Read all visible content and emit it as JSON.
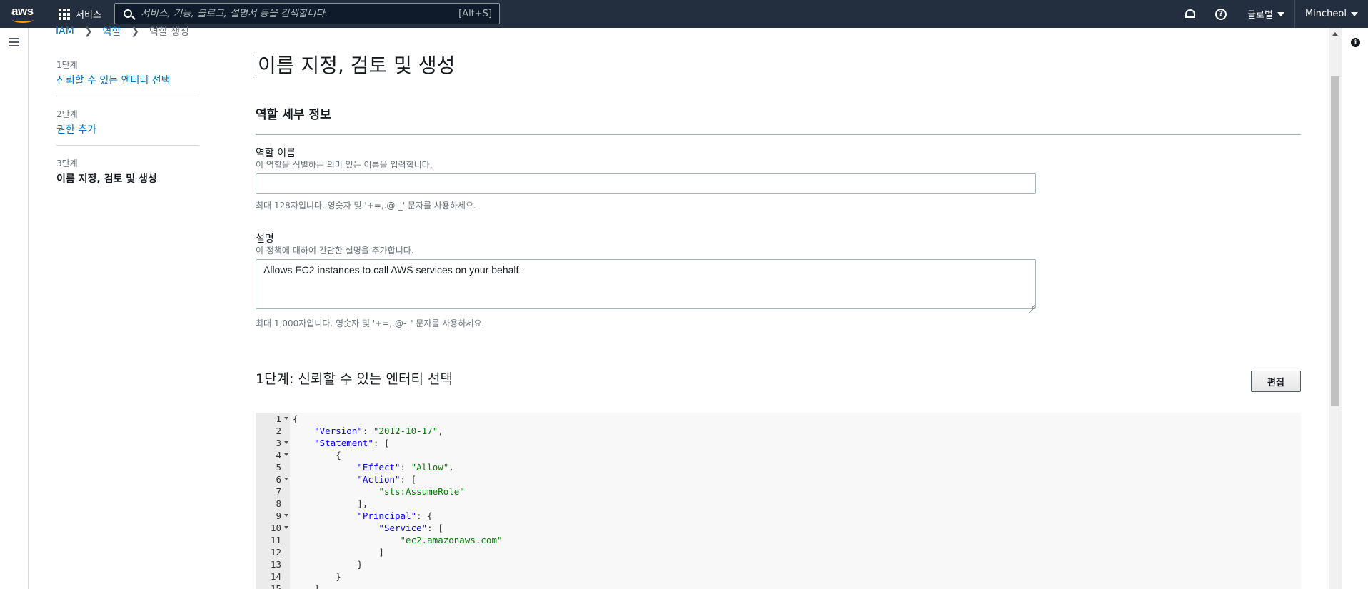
{
  "topnav": {
    "logo": "aws",
    "services_label": "서비스",
    "search_placeholder": "서비스, 기능, 블로그, 설명서 등을 검색합니다.",
    "search_shortcut": "[Alt+S]",
    "region_label": "글로벌",
    "account_label": "Mincheol",
    "icons": [
      "grid-icon",
      "search-icon",
      "bell-icon",
      "help-icon",
      "caret-down-icon"
    ]
  },
  "breadcrumb": {
    "items": [
      "IAM",
      "역할",
      "역할 생성"
    ]
  },
  "steps": [
    {
      "num": "1단계",
      "label": "신뢰할 수 있는 엔터티 선택",
      "state": "link"
    },
    {
      "num": "2단계",
      "label": "권한 추가",
      "state": "link"
    },
    {
      "num": "3단계",
      "label": "이름 지정, 검토 및 생성",
      "state": "active"
    }
  ],
  "page": {
    "title": "이름 지정, 검토 및 생성",
    "section_title": "역할 세부 정보"
  },
  "role_name": {
    "label": "역할 이름",
    "description": "이 역할을 식별하는 의미 있는 이름을 입력합니다.",
    "value": "",
    "hint": "최대 128자입니다. 영숫자 및 '+=,.@-_' 문자를 사용하세요."
  },
  "role_description": {
    "label": "설명",
    "description": "이 정책에 대하여 간단한 설명을 추가합니다.",
    "value": "Allows EC2 instances to call AWS services on your behalf.",
    "hint": "최대 1,000자입니다. 영숫자 및 '+=,.@-_' 문자를 사용하세요."
  },
  "step1": {
    "title": "1단계: 신뢰할 수 있는 엔터티 선택",
    "edit_label": "편집"
  },
  "policy_editor": {
    "lines": [
      {
        "n": "1",
        "fold": true,
        "text": "{"
      },
      {
        "n": "2",
        "fold": false,
        "text": "    \"Version\": \"2012-10-17\","
      },
      {
        "n": "3",
        "fold": true,
        "text": "    \"Statement\": ["
      },
      {
        "n": "4",
        "fold": true,
        "text": "        {"
      },
      {
        "n": "5",
        "fold": false,
        "text": "            \"Effect\": \"Allow\","
      },
      {
        "n": "6",
        "fold": true,
        "text": "            \"Action\": ["
      },
      {
        "n": "7",
        "fold": false,
        "text": "                \"sts:AssumeRole\""
      },
      {
        "n": "8",
        "fold": false,
        "text": "            ],"
      },
      {
        "n": "9",
        "fold": true,
        "text": "            \"Principal\": {"
      },
      {
        "n": "10",
        "fold": true,
        "text": "                \"Service\": ["
      },
      {
        "n": "11",
        "fold": false,
        "text": "                    \"ec2.amazonaws.com\""
      },
      {
        "n": "12",
        "fold": false,
        "text": "                ]"
      },
      {
        "n": "13",
        "fold": false,
        "text": "            }"
      },
      {
        "n": "14",
        "fold": false,
        "text": "        }"
      },
      {
        "n": "15",
        "fold": false,
        "text": "    ]"
      }
    ]
  },
  "colors": {
    "nav_bg": "#232f3e",
    "link": "#0073bb",
    "accent": "#ff9900",
    "json_key": "#0000ff",
    "json_string": "#008000"
  }
}
